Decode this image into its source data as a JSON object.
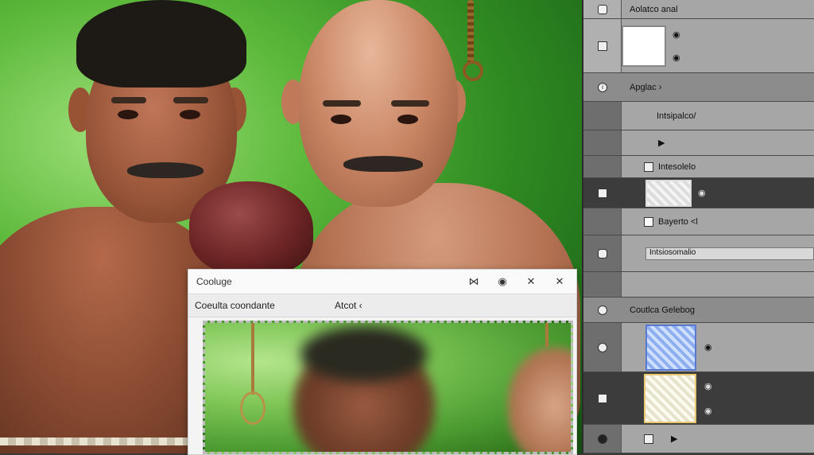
{
  "panel": {
    "header_label": "Aolatco anal",
    "adjust_label": "Apglac  ›",
    "layer1_label": "Intsipalco/",
    "layer2_label": "Intesolelo",
    "layer3_label": "Bayerto  <l",
    "slider_label": "Intsiosomalio  ­­",
    "section2_label": "Coutlca Gelebog",
    "eye_glyph": "◉",
    "link_glyph": "⇄"
  },
  "dialog": {
    "title": "Cooluge",
    "controls": [
      "⋈",
      "◉",
      "✕",
      "✕"
    ],
    "left_label": "Coeulta coondante",
    "right_label": "Atcot  ‹"
  },
  "colors": {
    "panel_bg": "#5c5c5c",
    "row_light": "#a6a6a6",
    "row_dark": "#3c3c3c",
    "canvas_green": "#2f8a22"
  }
}
